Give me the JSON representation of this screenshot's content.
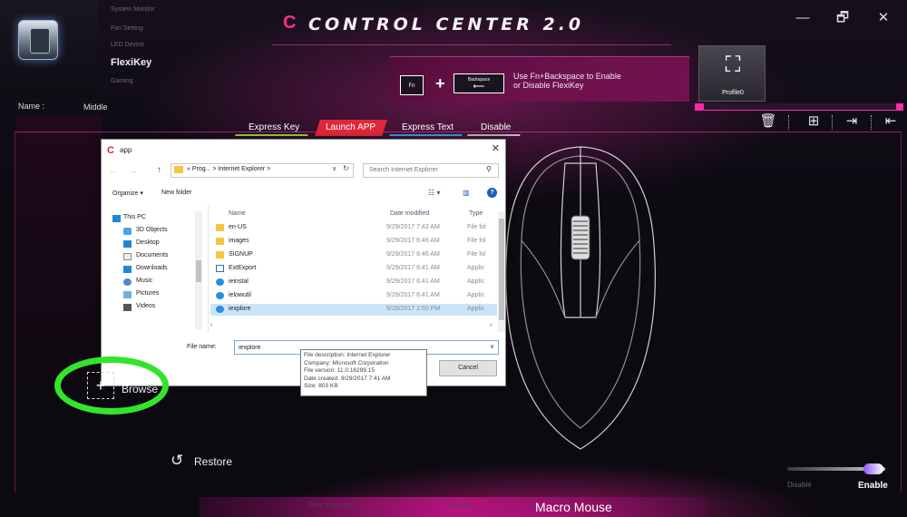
{
  "app": {
    "title": "CONTROL CENTER 2.0",
    "logo_glyph": "C",
    "window_controls": {
      "minimize": "—",
      "restore": "🗗",
      "close": "✕"
    }
  },
  "side_menu": {
    "items": [
      "System Monitor",
      "Fan Setting",
      "LED Device"
    ],
    "active": "FlexiKey",
    "next": "Gaming"
  },
  "name_row": {
    "label": "Name :",
    "value": "Middle"
  },
  "hint": {
    "key_fn": "Fn",
    "plus": "+",
    "key_backspace": "Backspace",
    "backspace_arrow": "⟵",
    "text_line1": "Use Fn+Backspace to Enable",
    "text_line2": "or Disable FlexiKey"
  },
  "profile": {
    "name": "Profile0",
    "icon": "crosshair-mouse-icon",
    "icon_glyph": "⛶"
  },
  "toolbar": {
    "delete_icon": "🗑",
    "add_icon": "⊞",
    "import_icon": "⇥",
    "export_icon": "⇤"
  },
  "mode_tabs": {
    "express_key": "Express Key",
    "launch_app": "Launch APP",
    "express_text": "Express Text",
    "disable": "Disable"
  },
  "file_dialog": {
    "title": "app",
    "close": "✕",
    "nav": {
      "back": "←",
      "forward": "→",
      "up": "↑",
      "dropdown": "∨",
      "refresh": "↻"
    },
    "address": "« Prog...  >  Internet Explorer  >",
    "search_placeholder": "Search Internet Explorer",
    "search_icon": "⚲",
    "organize": "Organize ▾",
    "new_folder": "New folder",
    "view_icon": "☷ ▾",
    "pane_icon": "▥",
    "help_icon": "?",
    "nav_items": [
      "This PC",
      "3D Objects",
      "Desktop",
      "Documents",
      "Downloads",
      "Music",
      "Pictures",
      "Videos"
    ],
    "columns": {
      "name": "Name",
      "date": "Date modified",
      "type": "Type"
    },
    "files": [
      {
        "name": "en-US",
        "date": "9/29/2017 7:42 AM",
        "type": "File fol",
        "kind": "folder"
      },
      {
        "name": "images",
        "date": "9/29/2017 6:46 AM",
        "type": "File fol",
        "kind": "folder"
      },
      {
        "name": "SIGNUP",
        "date": "9/29/2017 6:46 AM",
        "type": "File fol",
        "kind": "folder"
      },
      {
        "name": "ExtExport",
        "date": "9/29/2017 6:41 AM",
        "type": "Applic",
        "kind": "app"
      },
      {
        "name": "ieinstal",
        "date": "9/29/2017 6:41 AM",
        "type": "Applic",
        "kind": "ie"
      },
      {
        "name": "ielowutil",
        "date": "9/29/2017 6:41 AM",
        "type": "Applic",
        "kind": "ie"
      },
      {
        "name": "iexplore",
        "date": "9/28/2017 1:50 PM",
        "type": "Applic",
        "kind": "ie"
      }
    ],
    "file_name_label": "File name:",
    "file_name_value": "iexplore",
    "cancel": "Cancel"
  },
  "tooltip": {
    "lines": [
      "File description: Internet Explorer",
      "Company: Microsoft Corporation",
      "File version: 11.0.16299.15",
      "Date created: 9/29/2017 7:41 AM",
      "Size: 803 KB"
    ]
  },
  "browse": {
    "icon": "+",
    "label": "Browse"
  },
  "restore": {
    "icon": "↺",
    "label": "Restore"
  },
  "toggle": {
    "off_label": "Disable",
    "on_label": "Enable",
    "state": "on"
  },
  "bottom_tabs": {
    "left": "Flexi Keyboard",
    "middle": "Mouse",
    "active": "Macro Mouse"
  },
  "colors": {
    "accent": "#ff2aa8",
    "launch_tab": "#e0273a",
    "express_key_tab": "#9ad23a",
    "express_text_tab": "#2ea0e6",
    "highlight": "#33e52a"
  }
}
